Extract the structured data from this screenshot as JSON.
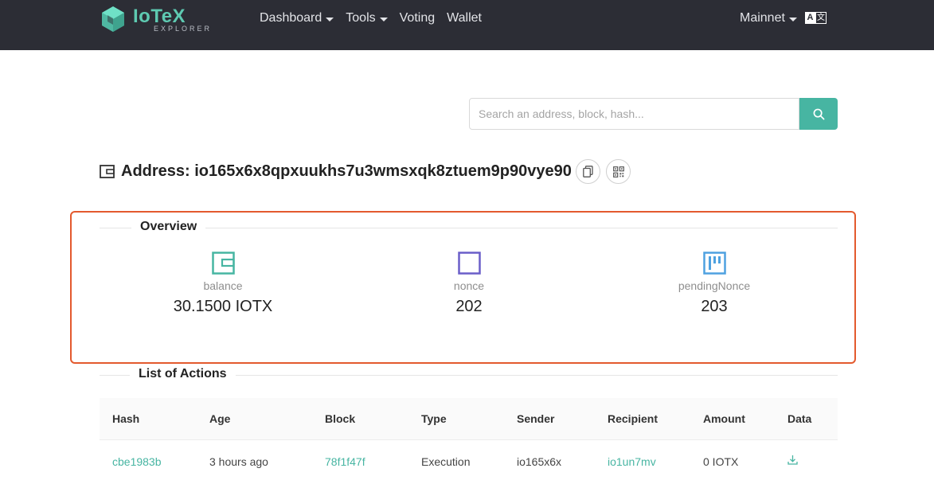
{
  "header": {
    "logo_title": "IoTeX",
    "logo_subtitle": "EXPLORER",
    "nav": [
      {
        "label": "Dashboard",
        "has_caret": true
      },
      {
        "label": "Tools",
        "has_caret": true
      },
      {
        "label": "Voting",
        "has_caret": false
      },
      {
        "label": "Wallet",
        "has_caret": false
      }
    ],
    "network_label": "Mainnet",
    "lang_icon": "translate-icon"
  },
  "search": {
    "placeholder": "Search an address, block, hash...",
    "value": "",
    "button_icon": "search-icon"
  },
  "address": {
    "label": "Address: io165x6x8qpxuukhs7u3wmsxqk8ztuem9p90vye90",
    "copy_icon": "copy-icon",
    "qr_icon": "qr-code-icon"
  },
  "overview": {
    "title": "Overview",
    "stats": [
      {
        "label": "balance",
        "value": "30.1500 IOTX",
        "icon": "wallet-icon",
        "color": "#47b5a2"
      },
      {
        "label": "nonce",
        "value": "202",
        "icon": "square-icon",
        "color": "#6a5ec9"
      },
      {
        "label": "pendingNonce",
        "value": "203",
        "icon": "pending-icon",
        "color": "#4ea1e0"
      }
    ]
  },
  "actions": {
    "title": "List of Actions",
    "columns": [
      "Hash",
      "Age",
      "Block",
      "Type",
      "Sender",
      "Recipient",
      "Amount",
      "Data"
    ],
    "rows": [
      {
        "hash": "cbe1983b",
        "age": "3 hours ago",
        "block": "78f1f47f",
        "type": "Execution",
        "sender": "io165x6x",
        "recipient": "io1un7mv",
        "amount": "0 IOTX",
        "data_icon": "download-icon"
      }
    ]
  },
  "colors": {
    "accent": "#47b5a2",
    "header_bg": "#2c2d35",
    "highlight": "#e35a2e"
  }
}
